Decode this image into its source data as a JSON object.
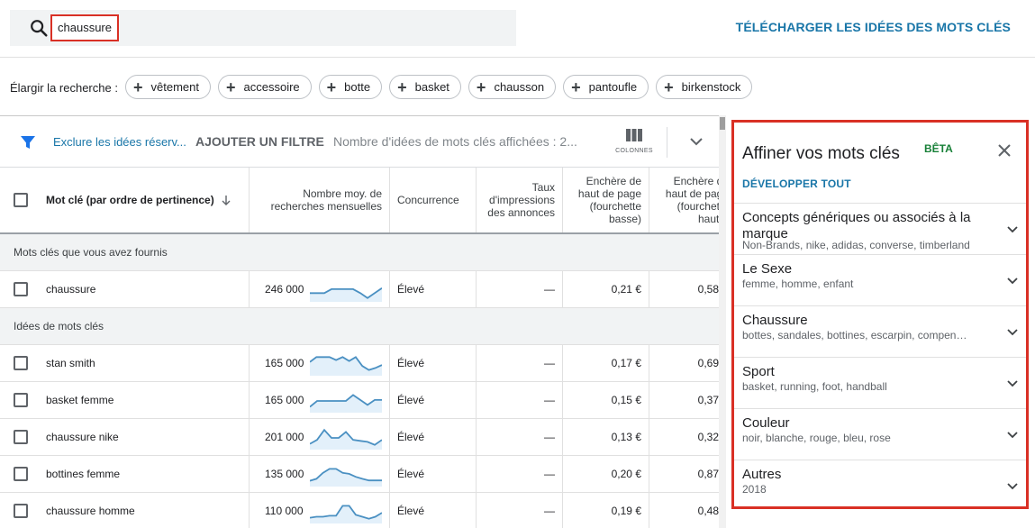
{
  "search": {
    "term": "chaussure"
  },
  "download_label": "TÉLÉCHARGER LES IDÉES DES MOTS CLÉS",
  "broaden": {
    "label": "Élargir la recherche :",
    "chips": [
      "vêtement",
      "accessoire",
      "botte",
      "basket",
      "chausson",
      "pantoufle",
      "birkenstock"
    ]
  },
  "filter_bar": {
    "exclude": "Exclure les idées réserv...",
    "add_filter": "AJOUTER UN FILTRE",
    "count": "Nombre d'idées de mots clés affichées : 2...",
    "columns_label": "COLONNES"
  },
  "table": {
    "headers": {
      "keyword": "Mot clé (par ordre de pertinence)",
      "searches": "Nombre moy. de recherches mensuelles",
      "competition": "Concurrence",
      "impressions": "Taux d'impressions des annonces",
      "bid_low": "Enchère de haut de page (fourchette basse)",
      "bid_high": "Enchère de haut de page (fourchette haute)"
    },
    "section_provided": "Mots clés que vous avez fournis",
    "section_ideas": "Idées de mots clés",
    "provided_rows": [
      {
        "keyword": "chaussure",
        "searches": "246 000",
        "competition": "Élevé",
        "impressions": "—",
        "bid_low": "0,21 €",
        "bid_high": "0,58",
        "trend": [
          0.35,
          0.35,
          0.35,
          0.55,
          0.55,
          0.55,
          0.55,
          0.35,
          0.1,
          0.35,
          0.6
        ]
      }
    ],
    "idea_rows": [
      {
        "keyword": "stan smith",
        "searches": "165 000",
        "competition": "Élevé",
        "impressions": "—",
        "bid_low": "0,17 €",
        "bid_high": "0,69",
        "trend": [
          0.6,
          0.85,
          0.85,
          0.85,
          0.7,
          0.85,
          0.65,
          0.85,
          0.4,
          0.2,
          0.3,
          0.45
        ]
      },
      {
        "keyword": "basket femme",
        "searches": "165 000",
        "competition": "Élevé",
        "impressions": "—",
        "bid_low": "0,15 €",
        "bid_high": "0,37",
        "trend": [
          0.2,
          0.5,
          0.5,
          0.5,
          0.5,
          0.5,
          0.8,
          0.55,
          0.3,
          0.55,
          0.55
        ]
      },
      {
        "keyword": "chaussure nike",
        "searches": "201 000",
        "competition": "Élevé",
        "impressions": "—",
        "bid_low": "0,13 €",
        "bid_high": "0,32",
        "trend": [
          0.2,
          0.4,
          0.9,
          0.5,
          0.5,
          0.8,
          0.4,
          0.35,
          0.3,
          0.15,
          0.4
        ]
      },
      {
        "keyword": "bottines femme",
        "searches": "135 000",
        "competition": "Élevé",
        "impressions": "—",
        "bid_low": "0,20 €",
        "bid_high": "0,87",
        "trend": [
          0.2,
          0.3,
          0.6,
          0.8,
          0.8,
          0.6,
          0.55,
          0.4,
          0.3,
          0.22,
          0.22,
          0.22
        ]
      },
      {
        "keyword": "chaussure homme",
        "searches": "110 000",
        "competition": "Élevé",
        "impressions": "—",
        "bid_low": "0,19 €",
        "bid_high": "0,48",
        "trend": [
          0.2,
          0.25,
          0.25,
          0.3,
          0.3,
          0.8,
          0.8,
          0.35,
          0.25,
          0.15,
          0.25,
          0.45
        ]
      }
    ]
  },
  "refine": {
    "title": "Affiner vos mots clés",
    "beta": "BÊTA",
    "expand_all": "DÉVELOPPER TOUT",
    "items": [
      {
        "title": "Concepts génériques ou associés à la marque",
        "subtitle": "Non-Brands, nike, adidas, converse, timberland"
      },
      {
        "title": "Le Sexe",
        "subtitle": "femme, homme, enfant"
      },
      {
        "title": "Chaussure",
        "subtitle": "bottes, sandales, bottines, escarpin, compensées"
      },
      {
        "title": "Sport",
        "subtitle": "basket, running, foot, handball"
      },
      {
        "title": "Couleur",
        "subtitle": "noir, blanche, rouge, bleu, rose"
      },
      {
        "title": "Autres",
        "subtitle": "2018"
      }
    ]
  },
  "colors": {
    "accent_blue": "#1976a8",
    "highlight_red": "#d93025",
    "beta_green": "#188038",
    "sparkline": "#4a90c2"
  }
}
